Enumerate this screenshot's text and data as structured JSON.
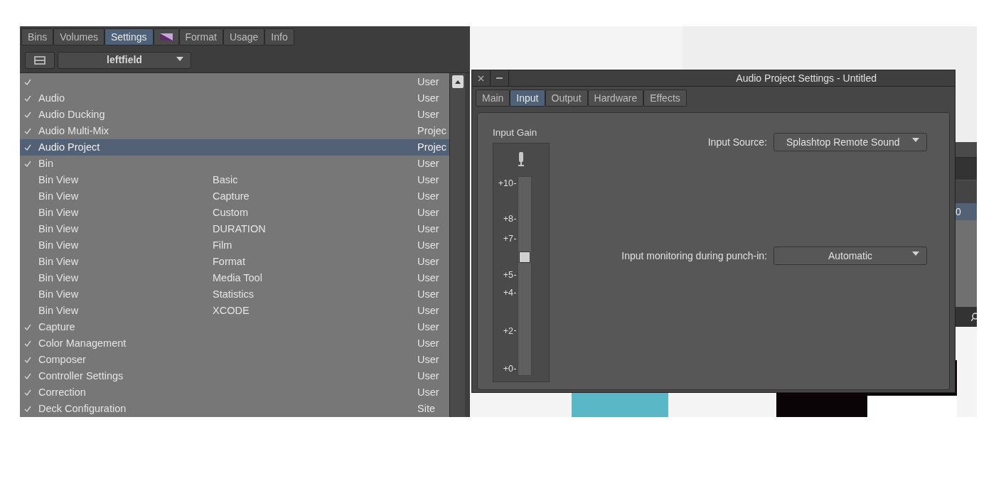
{
  "settings_panel": {
    "tabs": [
      {
        "kind": "text",
        "label": "Bins",
        "selected": false
      },
      {
        "kind": "text",
        "label": "Volumes",
        "selected": false
      },
      {
        "kind": "text",
        "label": "Settings",
        "selected": true
      },
      {
        "kind": "icon",
        "selected": false
      },
      {
        "kind": "text",
        "label": "Format",
        "selected": false
      },
      {
        "kind": "text",
        "label": "Usage",
        "selected": false
      },
      {
        "kind": "text",
        "label": "Info",
        "selected": false
      }
    ],
    "user_dropdown": {
      "value": "leftfield"
    },
    "rows": [
      {
        "checked": true,
        "name": "",
        "column_2": "",
        "column_3": "User",
        "selected": false
      },
      {
        "checked": true,
        "name": "Audio",
        "column_2": "",
        "column_3": "User",
        "selected": false
      },
      {
        "checked": true,
        "name": "Audio Ducking",
        "column_2": "",
        "column_3": "User",
        "selected": false
      },
      {
        "checked": true,
        "name": "Audio Multi-Mix",
        "column_2": "",
        "column_3": "Projec",
        "selected": false
      },
      {
        "checked": true,
        "name": "Audio Project",
        "column_2": "",
        "column_3": "Projec",
        "selected": true
      },
      {
        "checked": true,
        "name": "Bin",
        "column_2": "",
        "column_3": "User",
        "selected": false
      },
      {
        "checked": false,
        "name": "Bin View",
        "column_2": "Basic",
        "column_3": "User",
        "selected": false
      },
      {
        "checked": false,
        "name": "Bin View",
        "column_2": "Capture",
        "column_3": "User",
        "selected": false
      },
      {
        "checked": false,
        "name": "Bin View",
        "column_2": "Custom",
        "column_3": "User",
        "selected": false
      },
      {
        "checked": false,
        "name": "Bin View",
        "column_2": "DURATION",
        "column_3": "User",
        "selected": false
      },
      {
        "checked": false,
        "name": "Bin View",
        "column_2": "Film",
        "column_3": "User",
        "selected": false
      },
      {
        "checked": false,
        "name": "Bin View",
        "column_2": "Format",
        "column_3": "User",
        "selected": false
      },
      {
        "checked": false,
        "name": "Bin View",
        "column_2": "Media Tool",
        "column_3": "User",
        "selected": false
      },
      {
        "checked": false,
        "name": "Bin View",
        "column_2": "Statistics",
        "column_3": "User",
        "selected": false
      },
      {
        "checked": false,
        "name": "Bin View",
        "column_2": "XCODE",
        "column_3": "User",
        "selected": false
      },
      {
        "checked": true,
        "name": "Capture",
        "column_2": "",
        "column_3": "User",
        "selected": false
      },
      {
        "checked": true,
        "name": "Color Management",
        "column_2": "",
        "column_3": "User",
        "selected": false
      },
      {
        "checked": true,
        "name": "Composer",
        "column_2": "",
        "column_3": "User",
        "selected": false
      },
      {
        "checked": true,
        "name": "Controller Settings",
        "column_2": "",
        "column_3": "User",
        "selected": false
      },
      {
        "checked": true,
        "name": "Correction",
        "column_2": "",
        "column_3": "User",
        "selected": false
      },
      {
        "checked": true,
        "name": "Deck Configuration",
        "column_2": "",
        "column_3": "Site",
        "selected": false
      }
    ]
  },
  "background_window": {
    "row_text": "0"
  },
  "dialog": {
    "title": "Audio Project Settings - Untitled",
    "tabs": [
      {
        "label": "Main",
        "selected": false
      },
      {
        "label": "Input",
        "selected": true
      },
      {
        "label": "Output",
        "selected": false
      },
      {
        "label": "Hardware",
        "selected": false
      },
      {
        "label": "Effects",
        "selected": false
      }
    ],
    "input_gain": {
      "label": "Input Gain",
      "level": 0.59,
      "ticks": [
        "+10",
        "+8",
        "+7",
        "+5",
        "+4",
        "+2",
        "+0"
      ]
    },
    "input_source": {
      "label": "Input Source:",
      "value": "Splashtop Remote Sound"
    },
    "input_monitoring": {
      "label": "Input monitoring during punch-in:",
      "value": "Automatic"
    }
  }
}
